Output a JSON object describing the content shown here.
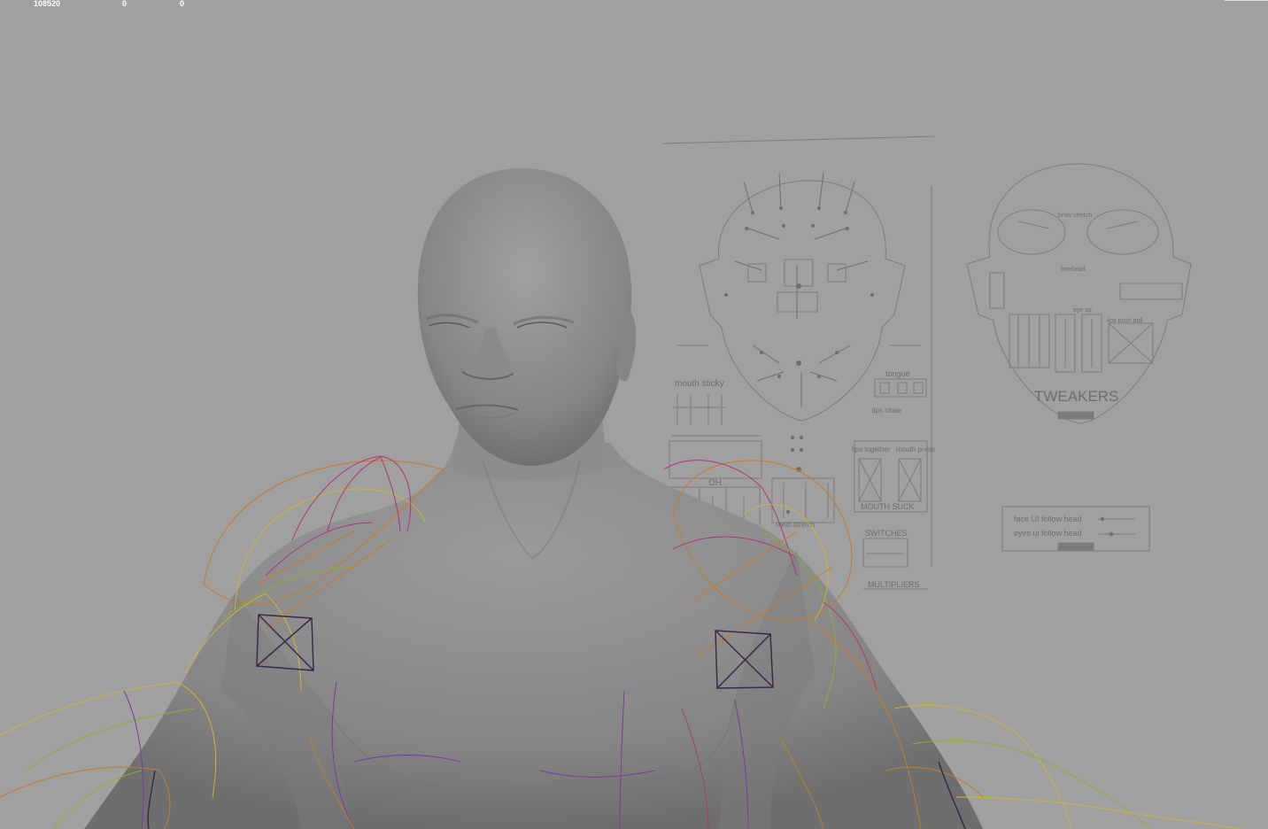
{
  "viewport": {
    "name": "3D viewport",
    "hud": {
      "vertex_count": "108520",
      "value_b": "0",
      "value_c": "0"
    },
    "face_picker": {
      "labels": {
        "mouth_sticky": "mouth sticky",
        "tongue": "tongue",
        "lips_close": "lips close",
        "oh": "OH",
        "lips_together": "lips together",
        "mouth_press": "mouth press",
        "mouth_suck": "MOUTH SUCK",
        "teeth_stretch": "teeth stretch",
        "switches": "SWITCHES",
        "multipliers": "MULTIPLIERS",
        "tweakers": "TWEAKERS",
        "face_ui_follow_head": "face UI follow head",
        "eyes_ui_follow_head": "eyes ui follow head",
        "brow_stretch": "brow stretch",
        "forehead": "forehead",
        "eye_sq": "eye sq",
        "lips_push_pull": "lips push pull"
      }
    },
    "colors": {
      "background": "#a0a0a0",
      "mesh": "#8a8a8a",
      "rig_orange": "#c87a2a",
      "rig_yellow": "#c8b43c",
      "rig_magenta": "#b0357a",
      "rig_purple": "#7a3aa8",
      "rig_green": "#8ab030",
      "picker_lines": "#7a7a7a"
    }
  }
}
